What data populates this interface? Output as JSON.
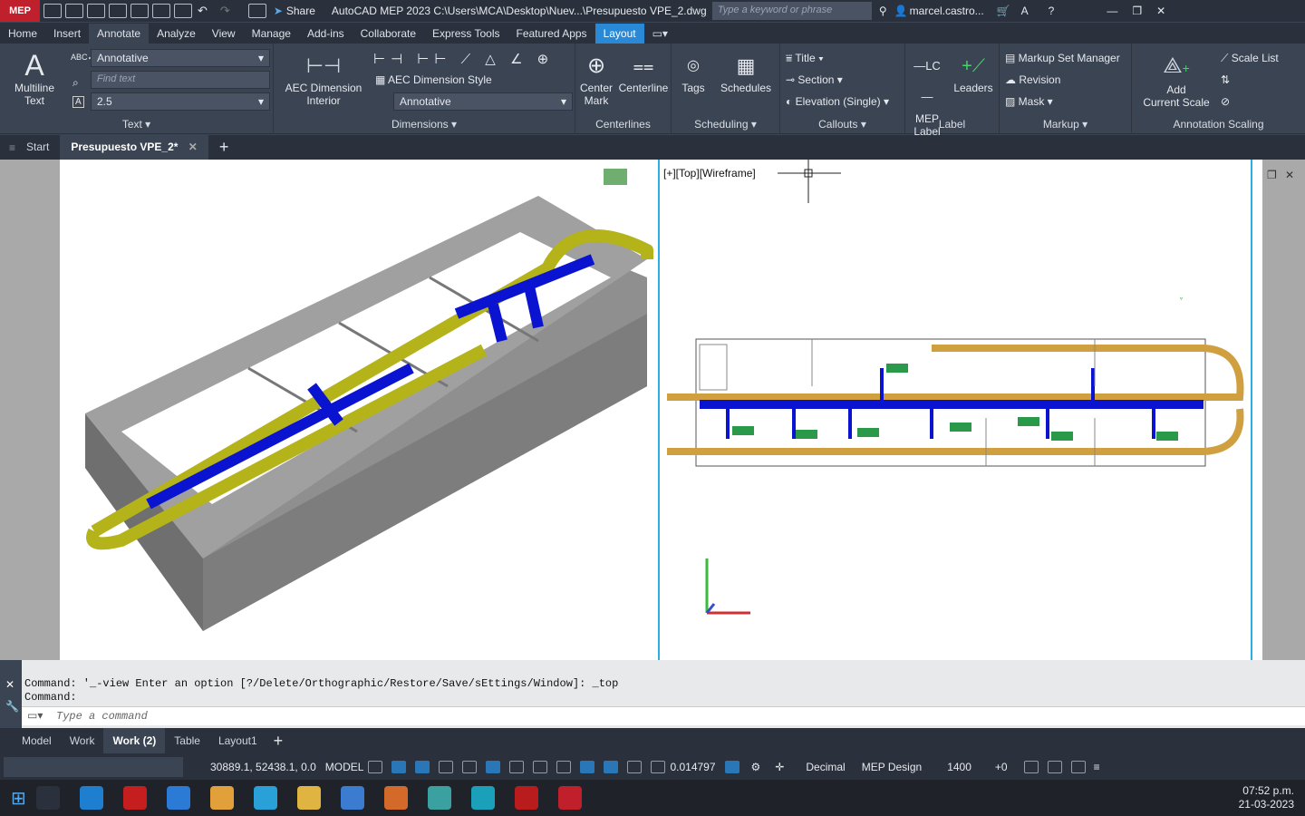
{
  "titlebar": {
    "app_badge": "MEP",
    "share_label": "Share",
    "title": "AutoCAD MEP 2023   C:\\Users\\MCA\\Desktop\\Nuev...\\Presupuesto VPE_2.dwg",
    "search_placeholder": "Type a keyword or phrase",
    "user": "marcel.castro..."
  },
  "ribbon_tabs": [
    "Home",
    "Insert",
    "Annotate",
    "Analyze",
    "View",
    "Manage",
    "Add-ins",
    "Collaborate",
    "Express Tools",
    "Featured Apps",
    "Layout"
  ],
  "text_panel": {
    "multiline_label": "Multiline\nText",
    "style": "Annotative",
    "find_placeholder": "Find text",
    "height": "2.5",
    "label": "Text"
  },
  "dimensions_panel": {
    "aec_dim_label": "AEC Dimension\nInterior",
    "aec_dim_style": "AEC Dimension Style",
    "dim_combo": "Annotative",
    "label": "Dimensions"
  },
  "centerlines_panel": {
    "center_mark": "Center\nMark",
    "centerline": "Centerline",
    "label": "Centerlines"
  },
  "scheduling_panel": {
    "tags": "Tags",
    "schedules": "Schedules",
    "label": "Scheduling"
  },
  "callouts_panel": {
    "title": "Title",
    "section": "Section",
    "elevation": "Elevation (Single)",
    "label": "Callouts"
  },
  "label_panel": {
    "mep_label": "MEP\nLabel",
    "leaders": "Leaders",
    "label": "Label"
  },
  "markup_panel": {
    "markup_set": "Markup Set Manager",
    "revision": "Revision",
    "mask": "Mask",
    "label": "Markup"
  },
  "annotation_scaling_panel": {
    "add_scale": "Add\nCurrent Scale",
    "scale_list": "Scale List",
    "label": "Annotation Scaling"
  },
  "doc_tabs": {
    "start": "Start",
    "active": "Presupuesto VPE_2*"
  },
  "viewport_label": "[+][Top][Wireframe]",
  "command": {
    "history1": "Command: '_-view Enter an option [?/Delete/Orthographic/Restore/Save/sEttings/Window]: _top",
    "history2": "Command:",
    "placeholder": "Type a command"
  },
  "layout_tabs": [
    "Model",
    "Work",
    "Work (2)",
    "Table",
    "Layout1"
  ],
  "layout_tab_active": "Work (2)",
  "status": {
    "coords": "30889.1, 52438.1, 0.0",
    "space": "MODEL",
    "scale": "0.014797",
    "units": "Decimal",
    "config": "MEP Design",
    "elev": "1400",
    "offset": "+0"
  },
  "taskbar": {
    "time": "07:52 p.m.",
    "date": "21-03-2023"
  },
  "colors": {
    "accent": "#2a89d6",
    "duct_supply": "#0a14d0",
    "duct_return": "#b5b31a",
    "app_red": "#c0202b"
  }
}
